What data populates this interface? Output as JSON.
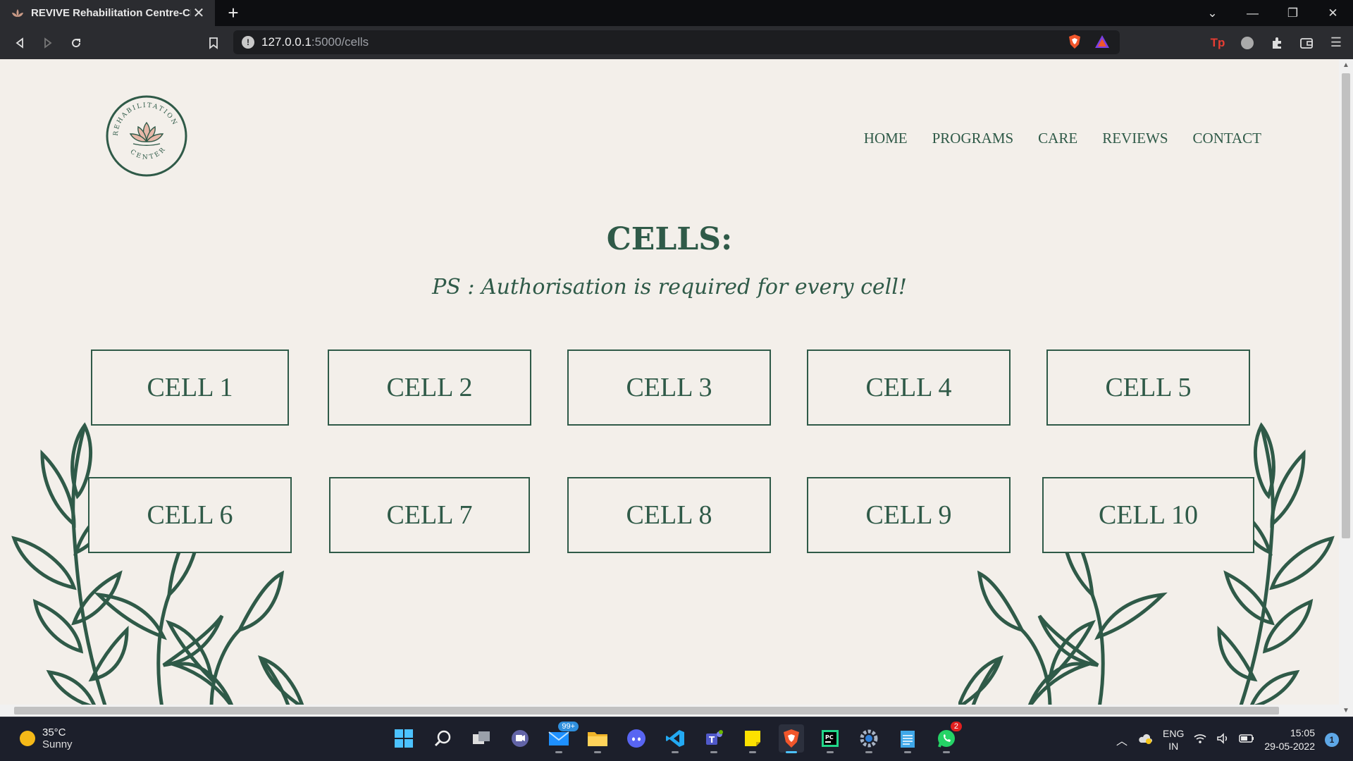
{
  "browser": {
    "tab_title": "REVIVE Rehabilitation Centre-CELLS",
    "url_host": "127.0.0.1",
    "url_path": ":5000/cells"
  },
  "site": {
    "logo_text_top": "REHABILITATION",
    "logo_text_bottom": "CENTER",
    "nav": [
      "HOME",
      "PROGRAMS",
      "CARE",
      "REVIEWS",
      "CONTACT"
    ],
    "heading": "CELLS:",
    "subheading": "PS : Authorisation is required for every cell!",
    "cells": [
      "CELL 1",
      "CELL 2",
      "CELL 3",
      "CELL 4",
      "CELL 5",
      "CELL 6",
      "CELL 7",
      "CELL 8",
      "CELL 9",
      "CELL 10"
    ]
  },
  "taskbar": {
    "temperature": "35°C",
    "weather": "Sunny",
    "mail_badge": "99+",
    "whatsapp_badge": "2",
    "lang_top": "ENG",
    "lang_bottom": "IN",
    "time": "15:05",
    "date": "29-05-2022",
    "notification_count": "1"
  },
  "colors": {
    "brand_green": "#2f5a48",
    "page_bg": "#f3efea",
    "lotus_pink": "#e6b7a8"
  }
}
